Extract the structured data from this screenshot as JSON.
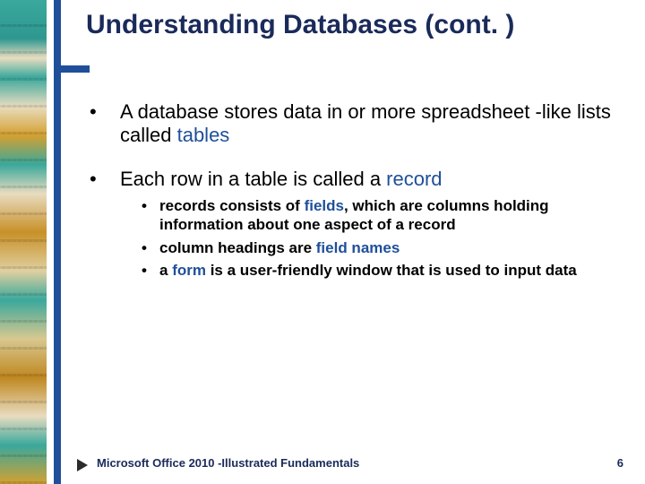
{
  "title": "Understanding Databases (cont. )",
  "bullets": [
    {
      "pre": "A database stores data in or more spreadsheet -like lists called ",
      "term": "tables",
      "post": ""
    },
    {
      "pre": "Each row in a table is called a ",
      "term": "record",
      "post": ""
    }
  ],
  "sub": [
    {
      "pre": "records consists of ",
      "term": "fields",
      "post": ", which are columns holding information about one aspect of a record"
    },
    {
      "pre": "column headings are ",
      "term": "field names",
      "post": ""
    },
    {
      "pre": "a ",
      "term": "form",
      "post": " is a user-friendly window that is used to input data"
    }
  ],
  "footer": {
    "left": "Microsoft Office 2010 -Illustrated Fundamentals",
    "page": "6"
  }
}
